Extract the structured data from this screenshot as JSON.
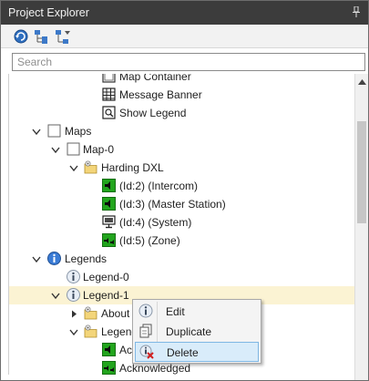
{
  "panel": {
    "title": "Project Explorer"
  },
  "search": {
    "placeholder": "Search",
    "value": ""
  },
  "tree": {
    "items": [
      {
        "label": "Map Container",
        "icon": "map-container-icon"
      },
      {
        "label": "Message Banner",
        "icon": "message-banner-icon"
      },
      {
        "label": "Show Legend",
        "icon": "show-legend-icon"
      },
      {
        "label": "Maps",
        "icon": "map-icon"
      },
      {
        "label": "Map-0",
        "icon": "map-icon"
      },
      {
        "label": "Harding DXL",
        "icon": "device-folder-icon"
      },
      {
        "label": "(Id:2) (Intercom)",
        "icon": "speaker-icon"
      },
      {
        "label": "(Id:3) (Master Station)",
        "icon": "speaker-icon"
      },
      {
        "label": "(Id:4) (System)",
        "icon": "monitor-icon"
      },
      {
        "label": "(Id:5) (Zone)",
        "icon": "zone-icon"
      },
      {
        "label": "Legends",
        "icon": "info-icon"
      },
      {
        "label": "Legend-0",
        "icon": "info-icon"
      },
      {
        "label": "Legend-1",
        "icon": "info-icon"
      },
      {
        "label": "About",
        "icon": "folder-icon"
      },
      {
        "label": "Legend",
        "icon": "folder-icon"
      },
      {
        "label": "Ac",
        "icon": "speaker-icon"
      },
      {
        "label": "Acknowledged",
        "icon": "zone-icon"
      }
    ]
  },
  "context_menu": {
    "items": [
      {
        "label": "Edit",
        "icon": "info-icon"
      },
      {
        "label": "Duplicate",
        "icon": "duplicate-icon"
      },
      {
        "label": "Delete",
        "icon": "delete-icon",
        "highlighted": true
      }
    ]
  },
  "colors": {
    "titlebar": "#3c3c3c",
    "selection": "#fbf3d3",
    "menu_highlight": "#d9ecfa",
    "device_green": "#22a51d"
  }
}
